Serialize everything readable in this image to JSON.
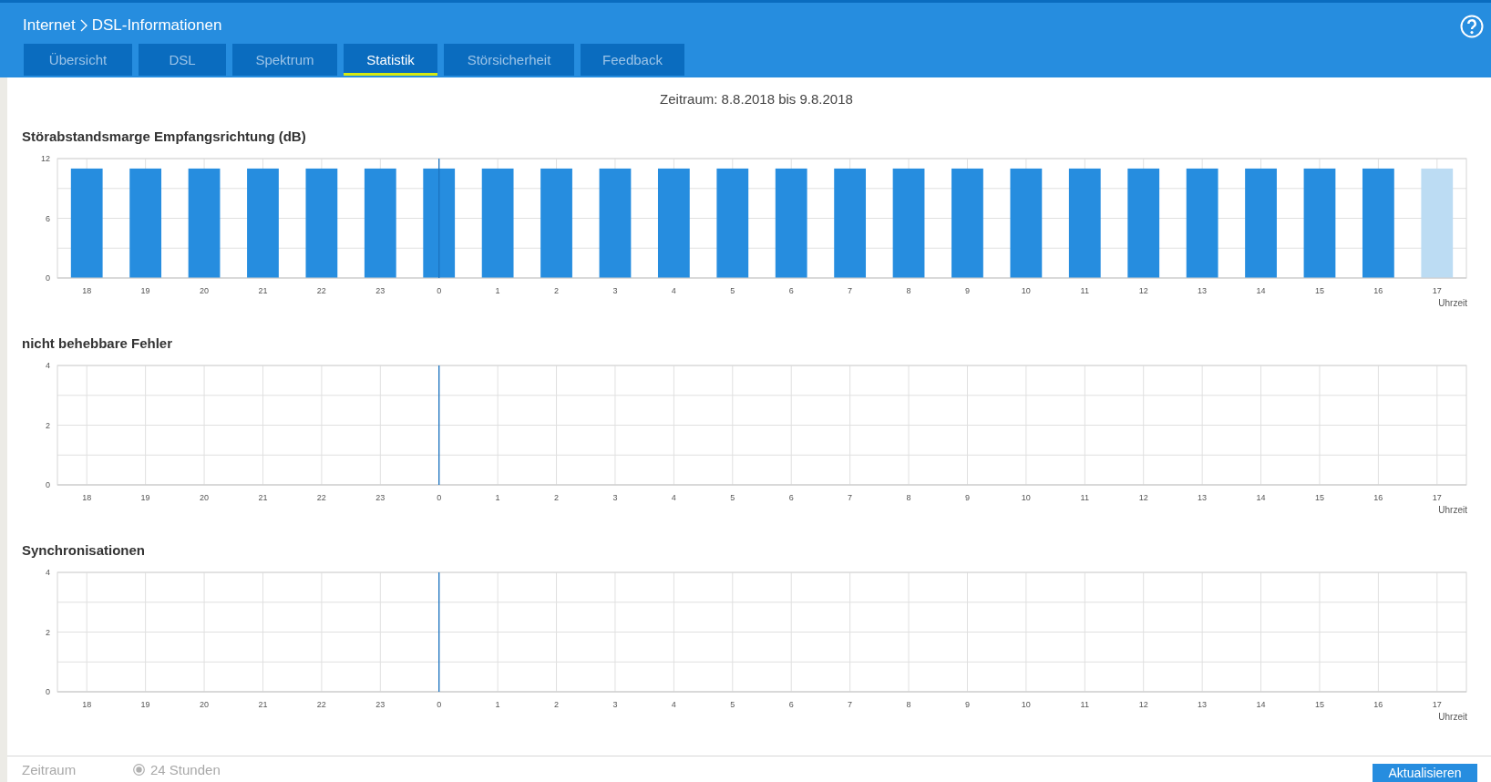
{
  "breadcrumb": [
    "Internet",
    "DSL-Informationen"
  ],
  "tabs": [
    {
      "label": "Übersicht",
      "selected": false
    },
    {
      "label": "DSL",
      "selected": false
    },
    {
      "label": "Spektrum",
      "selected": false
    },
    {
      "label": "Statistik",
      "selected": true
    },
    {
      "label": "Störsicherheit",
      "selected": false
    },
    {
      "label": "Feedback",
      "selected": false
    }
  ],
  "period": "Zeitraum: 8.8.2018 bis 9.8.2018",
  "charts": [
    {
      "chart_data": {
        "type": "bar",
        "title": "Störabstandsmarge Empfangsrichtung (dB)",
        "xlabel": "Uhrzeit",
        "categories": [
          "18",
          "19",
          "20",
          "21",
          "22",
          "23",
          "0",
          "1",
          "2",
          "3",
          "4",
          "5",
          "6",
          "7",
          "8",
          "9",
          "10",
          "11",
          "12",
          "13",
          "14",
          "15",
          "16",
          "17"
        ],
        "stacked": true,
        "ylim": [
          0,
          12
        ],
        "yticks": [
          0,
          6,
          12
        ],
        "series": [
          {
            "color": "#268ddf",
            "values": [
              11,
              11,
              11,
              11,
              11,
              11,
              11,
              11,
              11,
              11,
              11,
              11,
              11,
              11,
              11,
              11,
              11,
              11,
              11,
              11,
              11,
              11,
              11,
              null
            ]
          },
          {
            "color": "#bcdcf3",
            "values": [
              null,
              null,
              null,
              null,
              null,
              null,
              null,
              null,
              null,
              null,
              null,
              null,
              null,
              null,
              null,
              null,
              null,
              null,
              null,
              null,
              null,
              null,
              null,
              11
            ]
          }
        ],
        "grid": true,
        "ref_lines": [
          {
            "axis": "x",
            "value": "0",
            "color": "#1b73c0"
          }
        ]
      }
    },
    {
      "chart_data": {
        "type": "bar",
        "title": "nicht behebbare Fehler",
        "xlabel": "Uhrzeit",
        "categories": [
          "18",
          "19",
          "20",
          "21",
          "22",
          "23",
          "0",
          "1",
          "2",
          "3",
          "4",
          "5",
          "6",
          "7",
          "8",
          "9",
          "10",
          "11",
          "12",
          "13",
          "14",
          "15",
          "16",
          "17"
        ],
        "ylim": [
          0,
          4
        ],
        "yticks": [
          0,
          2,
          4
        ],
        "series": [
          {
            "values": [
              0,
              0,
              0,
              0,
              0,
              0,
              0,
              0,
              0,
              0,
              0,
              0,
              0,
              0,
              0,
              0,
              0,
              0,
              0,
              0,
              0,
              0,
              0,
              0
            ]
          }
        ],
        "grid": true,
        "ref_lines": [
          {
            "axis": "x",
            "value": "0",
            "color": "#1b73c0"
          }
        ]
      }
    },
    {
      "chart_data": {
        "type": "bar",
        "title": "Synchronisationen",
        "xlabel": "Uhrzeit",
        "categories": [
          "18",
          "19",
          "20",
          "21",
          "22",
          "23",
          "0",
          "1",
          "2",
          "3",
          "4",
          "5",
          "6",
          "7",
          "8",
          "9",
          "10",
          "11",
          "12",
          "13",
          "14",
          "15",
          "16",
          "17"
        ],
        "ylim": [
          0,
          4
        ],
        "yticks": [
          0,
          2,
          4
        ],
        "series": [
          {
            "values": [
              0,
              0,
              0,
              0,
              0,
              0,
              0,
              0,
              0,
              0,
              0,
              0,
              0,
              0,
              0,
              0,
              0,
              0,
              0,
              0,
              0,
              0,
              0,
              0
            ]
          }
        ],
        "grid": true,
        "ref_lines": [
          {
            "axis": "x",
            "value": "0",
            "color": "#1b73c0"
          }
        ]
      }
    }
  ],
  "footer": {
    "label": "Zeitraum",
    "disabled": true,
    "options": [
      {
        "label": "24 Stunden",
        "selected": true
      }
    ],
    "button": "Aktualisieren"
  }
}
